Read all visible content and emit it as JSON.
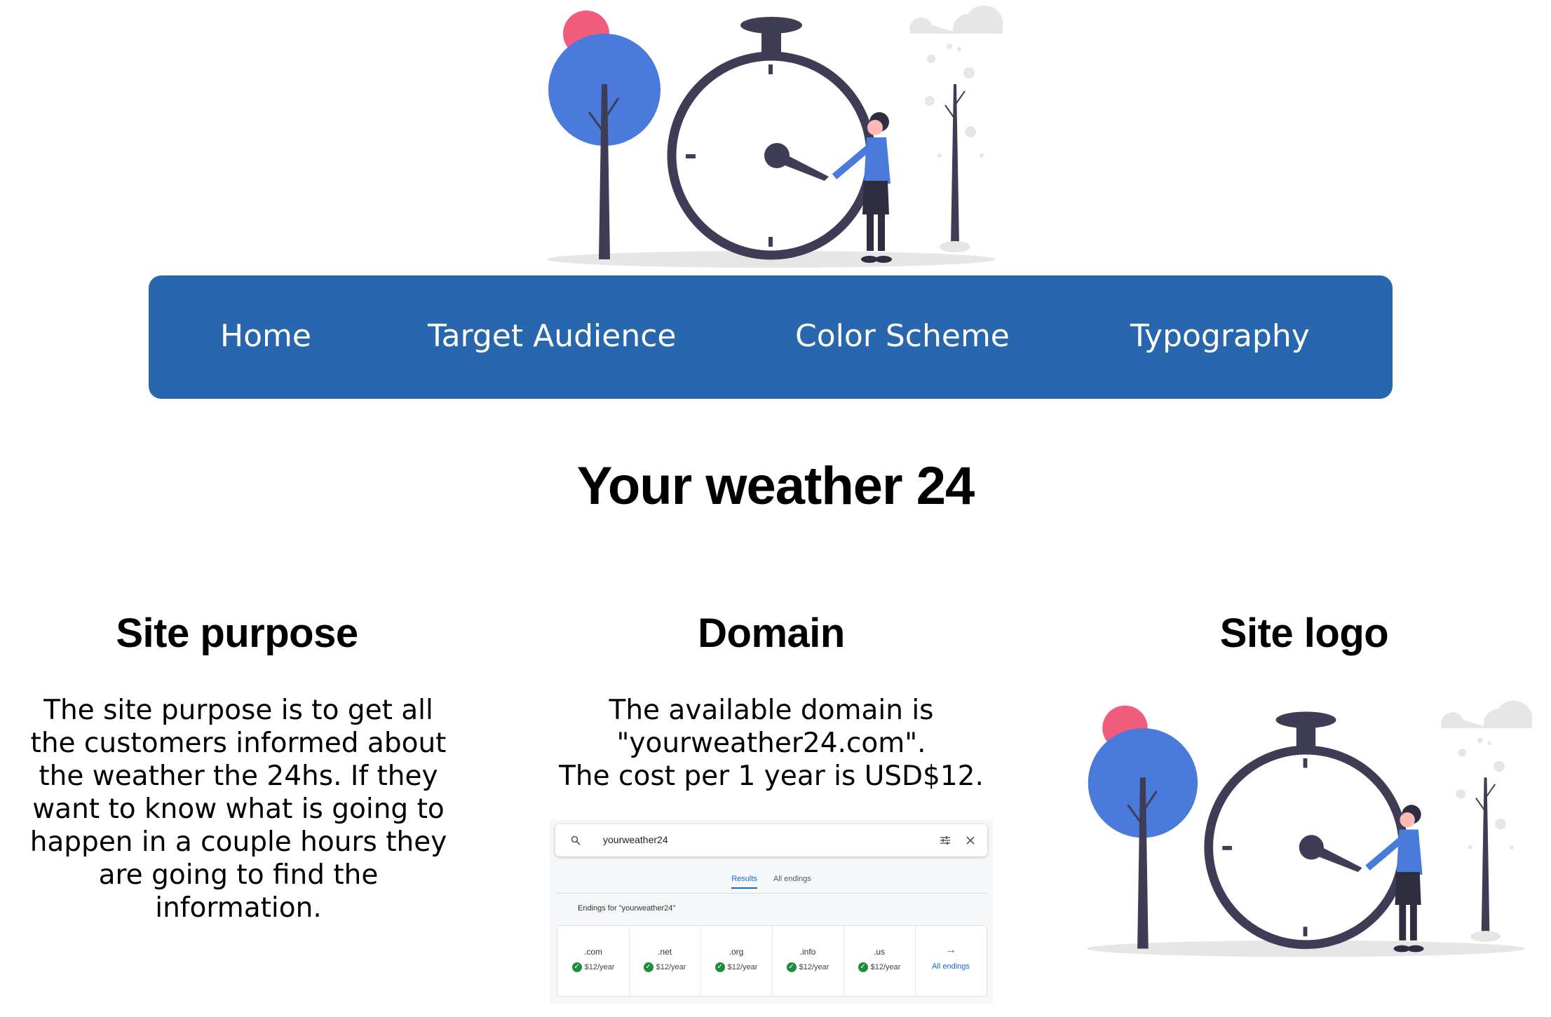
{
  "nav": {
    "items": [
      {
        "label": "Home"
      },
      {
        "label": "Target Audience"
      },
      {
        "label": "Color Scheme"
      },
      {
        "label": "Typography"
      }
    ]
  },
  "page": {
    "title": "Your weather 24"
  },
  "sections": {
    "purpose": {
      "heading": "Site purpose",
      "lines": [
        "The site purpose is to get all",
        "the customers informed about",
        "the weather the 24hs. If they",
        "want to know what is going to",
        "happen in a couple hours they",
        "are going to find the",
        "information."
      ]
    },
    "domain": {
      "heading": "Domain",
      "lines": [
        "The available domain is",
        "\"yourweather24.com\".",
        "The cost per 1 year is USD$12."
      ],
      "screenshot": {
        "query": "yourweather24",
        "tabs": [
          "Results",
          "All endings"
        ],
        "endings_label": "Endings for \"yourweather24\"",
        "results": [
          {
            "tld": ".com",
            "price": "$12/year"
          },
          {
            "tld": ".net",
            "price": "$12/year"
          },
          {
            "tld": ".org",
            "price": "$12/year"
          },
          {
            "tld": ".info",
            "price": "$12/year"
          },
          {
            "tld": ".us",
            "price": "$12/year"
          }
        ],
        "all_endings_label": "All endings"
      }
    },
    "logo": {
      "heading": "Site logo"
    }
  },
  "colors": {
    "nav_bg": "#2866ad",
    "accent_blue": "#4a7bdc",
    "accent_pink": "#f25c7c",
    "dark": "#3f3d56"
  }
}
